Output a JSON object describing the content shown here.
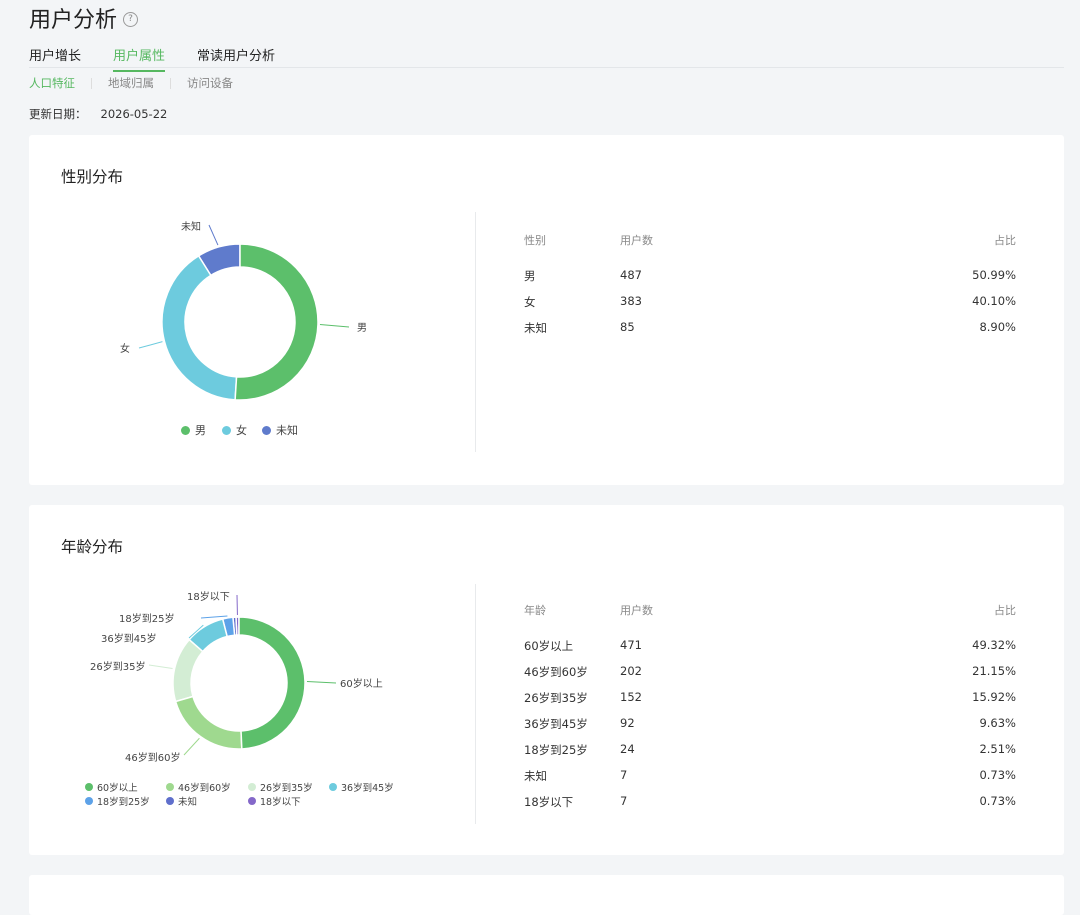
{
  "page": {
    "title": "用户分析",
    "help_glyph": "?"
  },
  "tabs": [
    {
      "label": "用户增长",
      "active": false
    },
    {
      "label": "用户属性",
      "active": true
    },
    {
      "label": "常读用户分析",
      "active": false
    }
  ],
  "subtabs": [
    {
      "label": "人口特征",
      "active": true
    },
    {
      "label": "地域归属",
      "active": false
    },
    {
      "label": "访问设备",
      "active": false
    }
  ],
  "update": {
    "label": "更新日期：",
    "date": "2026-05-22"
  },
  "colors": {
    "accent": "#56b860",
    "male": "#5cbf6b",
    "female": "#6dcbde",
    "unknown": "#5f7bcc",
    "age_60_plus": "#5cbf6b",
    "age_46_60": "#9fd98f",
    "age_26_35": "#d3edd4",
    "age_36_45": "#6dcbde",
    "age_18_25": "#5da2e8",
    "age_unknown": "#5f6fcc",
    "age_under_18": "#8468c9"
  },
  "gender_section": {
    "title": "性别分布",
    "table_headers": {
      "name": "性别",
      "count": "用户数",
      "ratio": "占比"
    },
    "rows": [
      {
        "name": "男",
        "count": "487",
        "ratio": "50.99%"
      },
      {
        "name": "女",
        "count": "383",
        "ratio": "40.10%"
      },
      {
        "name": "未知",
        "count": "85",
        "ratio": "8.90%"
      }
    ]
  },
  "age_section": {
    "title": "年龄分布",
    "table_headers": {
      "name": "年龄",
      "count": "用户数",
      "ratio": "占比"
    },
    "rows": [
      {
        "name": "60岁以上",
        "count": "471",
        "ratio": "49.32%"
      },
      {
        "name": "46岁到60岁",
        "count": "202",
        "ratio": "21.15%"
      },
      {
        "name": "26岁到35岁",
        "count": "152",
        "ratio": "15.92%"
      },
      {
        "name": "36岁到45岁",
        "count": "92",
        "ratio": "9.63%"
      },
      {
        "name": "18岁到25岁",
        "count": "24",
        "ratio": "2.51%"
      },
      {
        "name": "未知",
        "count": "7",
        "ratio": "0.73%"
      },
      {
        "name": "18岁以下",
        "count": "7",
        "ratio": "0.73%"
      }
    ]
  },
  "chart_data": [
    {
      "type": "pie",
      "title": "",
      "categories": [
        "男",
        "女",
        "未知"
      ],
      "values": [
        487,
        383,
        85
      ],
      "colors": [
        "#5cbf6b",
        "#6dcbde",
        "#5f7bcc"
      ],
      "legend": "bottom"
    },
    {
      "type": "pie",
      "title": "",
      "categories": [
        "60岁以上",
        "46岁到60岁",
        "26岁到35岁",
        "36岁到45岁",
        "18岁到25岁",
        "未知",
        "18岁以下"
      ],
      "values": [
        471,
        202,
        152,
        92,
        24,
        7,
        7
      ],
      "colors": [
        "#5cbf6b",
        "#9fd98f",
        "#d3edd4",
        "#6dcbde",
        "#5da2e8",
        "#5f6fcc",
        "#8468c9"
      ],
      "legend": "bottom"
    }
  ]
}
